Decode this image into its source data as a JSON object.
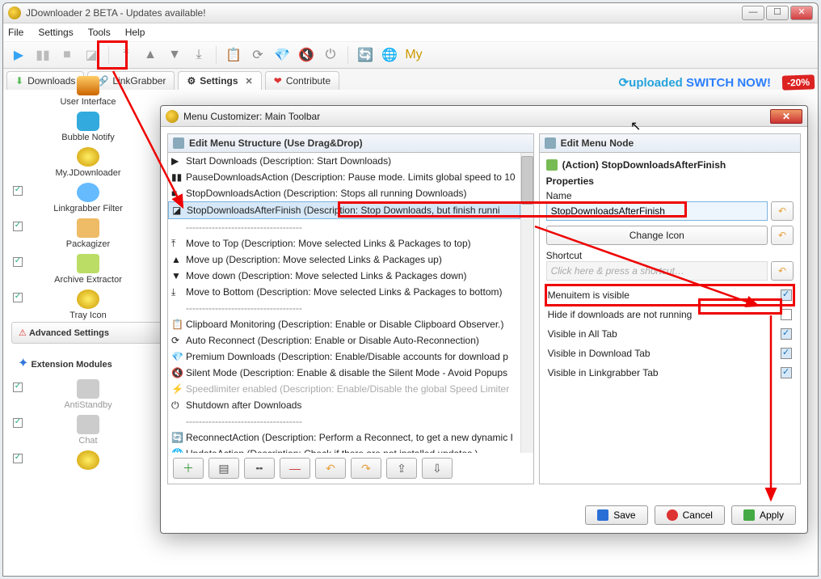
{
  "window": {
    "title": "JDownloader 2 BETA - Updates available!"
  },
  "menu": [
    "File",
    "Settings",
    "Tools",
    "Help"
  ],
  "tabs": {
    "items": [
      {
        "label": "Downloads",
        "icon": "download-icon"
      },
      {
        "label": "LinkGrabber",
        "icon": "link-icon"
      },
      {
        "label": "Settings",
        "icon": "gear-icon",
        "active": true,
        "closeable": true
      },
      {
        "label": "Contribute",
        "icon": "heart-icon"
      }
    ],
    "promo_prefix": "uploaded",
    "promo_suffix": " SWITCH NOW!",
    "discount": "-20%"
  },
  "sidebar": {
    "items": [
      {
        "label": "User Interface"
      },
      {
        "label": "Bubble Notify"
      },
      {
        "label": "My.JDownloader"
      },
      {
        "label": "Linkgrabber Filter",
        "check": true
      },
      {
        "label": "Packagizer",
        "check": true
      },
      {
        "label": "Archive Extractor",
        "check": true
      },
      {
        "label": "Tray Icon",
        "check": true
      },
      {
        "label": "Advanced Settings",
        "selected": true
      },
      {
        "label": "Extension Modules",
        "section": true
      },
      {
        "label": "AntiStandby",
        "check": true
      },
      {
        "label": "Chat",
        "check": true
      }
    ],
    "advanced_icon": "warning-icon"
  },
  "dialog": {
    "title": "Menu Customizer: Main Toolbar",
    "left_header": "Edit Menu Structure (Use Drag&Drop)",
    "right_header": "Edit Menu Node",
    "sep": "------------------------------------",
    "items": [
      "Start Downloads (Description: Start Downloads)",
      "PauseDownloadsAction (Description: Pause mode. Limits global speed to 10",
      "StopDownloadsAction (Description: Stops all running Downloads)",
      "StopDownloadsAfterFinish (Description: Stop Downloads, but finish runni",
      "sep",
      "Move to Top (Description: Move selected Links & Packages to top)",
      "Move up (Description: Move selected Links & Packages up)",
      "Move down (Description: Move selected Links & Packages down)",
      "Move to Bottom (Description: Move selected Links & Packages to bottom)",
      "sep",
      "Clipboard Monitoring (Description: Enable or Disable Clipboard Observer.)",
      "Auto Reconnect (Description: Enable or Disable Auto-Reconnection)",
      "Premium Downloads (Description: Enable/Disable accounts for download p",
      "Silent Mode (Description: Enable & disable the Silent Mode - Avoid Popups",
      "Speedlimiter enabled (Description: Enable/Disable the global Speed Limiter",
      "Shutdown after Downloads",
      "sep",
      "ReconnectAction (Description: Perform a Reconnect, to get a new dynamic I",
      "UpdateAction (Description: Check if there are not installed updates.)",
      "sep"
    ],
    "selected_index": 3,
    "disabled_index": 14,
    "node": {
      "action_label": "(Action) StopDownloadsAfterFinish",
      "properties_label": "Properties",
      "name_label": "Name",
      "name_value": "StopDownloadsAfterFinish",
      "change_icon": "Change Icon",
      "shortcut_label": "Shortcut",
      "shortcut_placeholder": "Click here & press a shortcut…",
      "checks": [
        {
          "label": "Menuitem is visible",
          "on": true,
          "highlight": true
        },
        {
          "label": "Hide if downloads are not running",
          "on": false
        },
        {
          "label": "Visible in All Tab",
          "on": true
        },
        {
          "label": "Visible in Download Tab",
          "on": true
        },
        {
          "label": "Visible in Linkgrabber Tab",
          "on": true
        }
      ]
    },
    "footer": {
      "save": "Save",
      "cancel": "Cancel",
      "apply": "Apply"
    }
  }
}
